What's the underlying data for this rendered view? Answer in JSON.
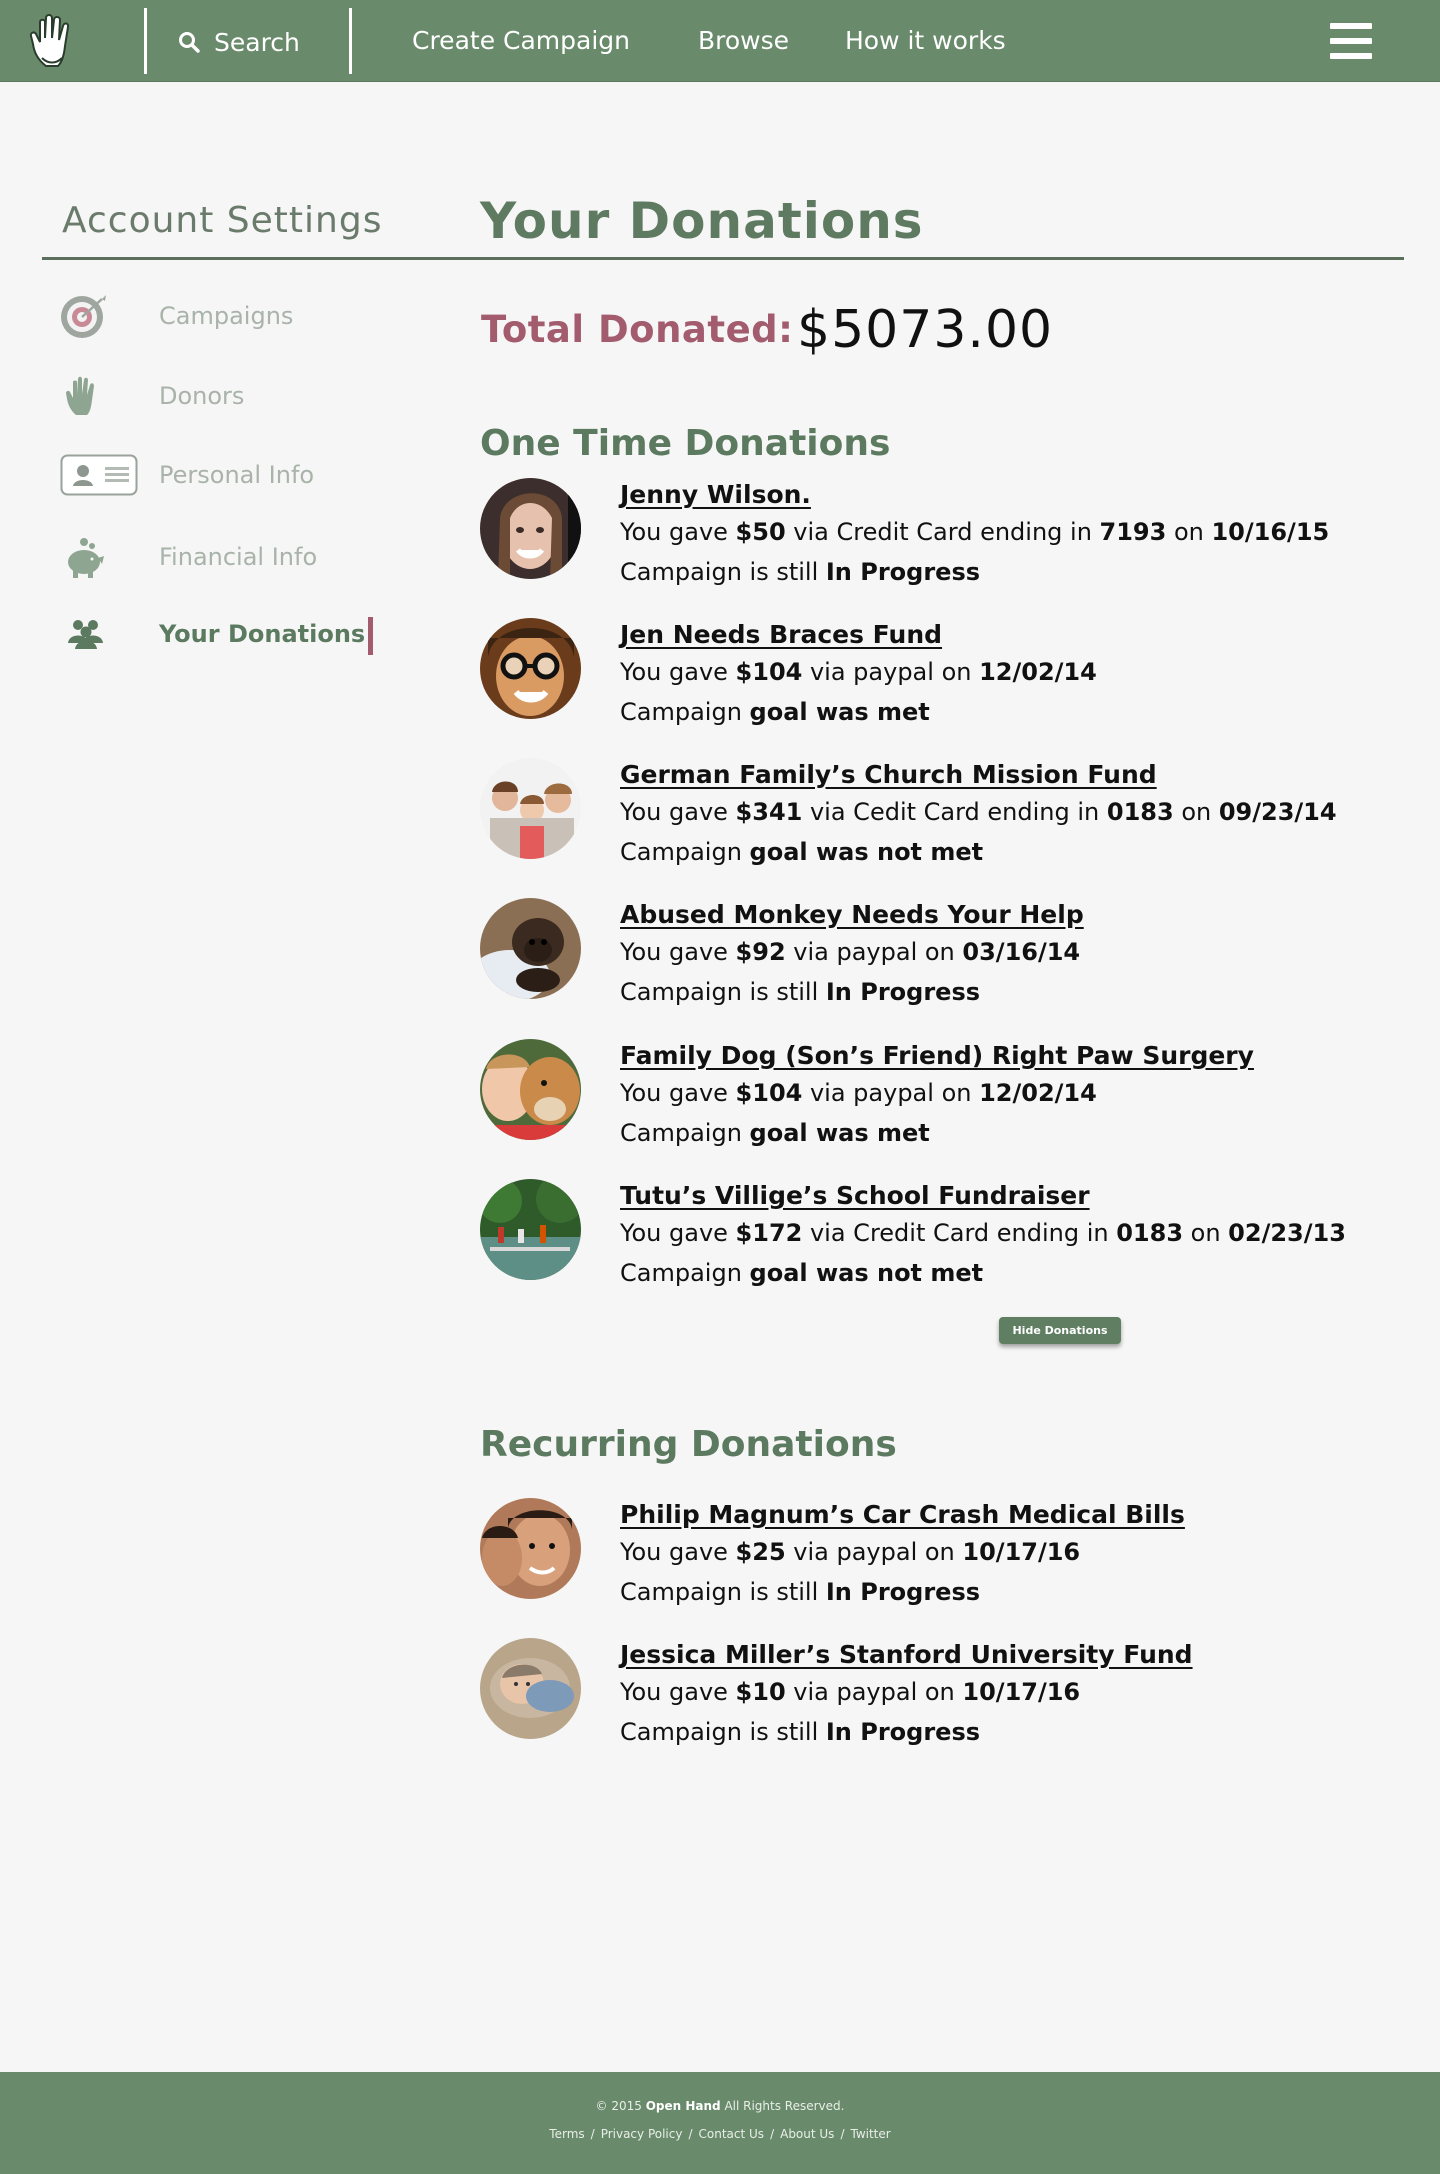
{
  "header": {
    "search_label": "Search",
    "nav": [
      "Create Campaign",
      "Browse",
      "How it works"
    ],
    "logo_icon": "hand-logo-icon",
    "menu_icon": "hamburger-menu-icon"
  },
  "sidebar": {
    "title": "Account Settings",
    "items": [
      {
        "label": "Campaigns",
        "icon": "target-icon"
      },
      {
        "label": "Donors",
        "icon": "hand-icon"
      },
      {
        "label": "Personal Info",
        "icon": "id-card-icon"
      },
      {
        "label": "Financial Info",
        "icon": "piggy-bank-icon"
      },
      {
        "label": "Your Donations",
        "icon": "people-icon",
        "active": true
      }
    ]
  },
  "main": {
    "title": "Your Donations",
    "total_label": "Total Donated:",
    "total_value": "$5073.00",
    "one_time_title": "One Time Donations",
    "recurring_title": "Recurring Donations",
    "hide_button": "Hide Donations"
  },
  "one_time": [
    {
      "title": "Jenny Wilson.",
      "line1": [
        "You gave ",
        "$50",
        " via Credit Card ending in ",
        "7193",
        " on ",
        "10/16/15"
      ],
      "line2": [
        "Campaign is still ",
        "In Progress"
      ]
    },
    {
      "title": "Jen Needs Braces Fund",
      "line1": [
        "You gave ",
        "$104",
        " via paypal on ",
        "12/02/14",
        "",
        ""
      ],
      "line2": [
        "Campaign ",
        "goal was met"
      ]
    },
    {
      "title": "German Family’s Church Mission Fund",
      "line1": [
        "You gave ",
        "$341",
        " via Cedit Card ending in ",
        "0183",
        " on ",
        "09/23/14"
      ],
      "line2": [
        "Campaign ",
        "goal was not met"
      ]
    },
    {
      "title": "Abused Monkey Needs Your Help",
      "line1": [
        "You gave ",
        "$92",
        " via paypal on ",
        "03/16/14",
        "",
        ""
      ],
      "line2": [
        "Campaign is still ",
        "In Progress"
      ]
    },
    {
      "title": "Family Dog (Son’s Friend) Right Paw Surgery",
      "line1": [
        "You gave ",
        "$104",
        " via paypal on ",
        "12/02/14",
        "",
        ""
      ],
      "line2": [
        "Campaign ",
        "goal was met"
      ]
    },
    {
      "title": "Tutu’s Villige’s School Fundraiser",
      "line1": [
        "You gave ",
        "$172",
        " via Credit Card ending in ",
        "0183",
        " on ",
        "02/23/13"
      ],
      "line2": [
        "Campaign ",
        "goal was not met"
      ]
    }
  ],
  "recurring": [
    {
      "title": "Philip Magnum’s Car Crash Medical Bills",
      "line1": [
        "You gave ",
        "$25",
        " via paypal on ",
        "10/17/16",
        "",
        ""
      ],
      "line2": [
        "Campaign is still ",
        "In Progress"
      ]
    },
    {
      "title": "Jessica Miller’s Stanford University Fund",
      "line1": [
        "You gave ",
        "$10",
        " via paypal on ",
        "10/17/16",
        "",
        ""
      ],
      "line2": [
        "Campaign is still ",
        "In Progress"
      ]
    }
  ],
  "footer": {
    "copy_prefix": "© 2015 ",
    "brand": "Open Hand",
    "copy_suffix": " All Rights Reserved.",
    "links": [
      "Terms",
      "Privacy Policy",
      "Contact Us",
      "About Us",
      "Twitter"
    ]
  },
  "colors": {
    "header": "#6a8a6c",
    "accent": "#a35b6e",
    "green_text": "#5b7a5f"
  }
}
